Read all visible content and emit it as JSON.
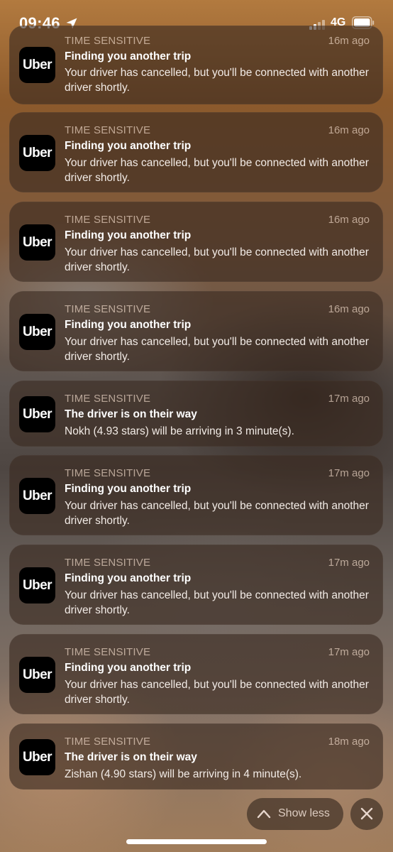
{
  "status_bar": {
    "time": "09:46",
    "network": "4G",
    "icons": [
      "location-arrow-icon",
      "signal-icon",
      "battery-icon"
    ]
  },
  "notifications": [
    {
      "app_icon_label": "Uber",
      "category": "TIME SENSITIVE",
      "time": "16m ago",
      "title": "Finding you another trip",
      "body": "Your driver has cancelled, but you'll be connected with another driver shortly."
    },
    {
      "app_icon_label": "Uber",
      "category": "TIME SENSITIVE",
      "time": "16m ago",
      "title": "Finding you another trip",
      "body": "Your driver has cancelled, but you'll be connected with another driver shortly."
    },
    {
      "app_icon_label": "Uber",
      "category": "TIME SENSITIVE",
      "time": "16m ago",
      "title": "Finding you another trip",
      "body": "Your driver has cancelled, but you'll be connected with another driver shortly."
    },
    {
      "app_icon_label": "Uber",
      "category": "TIME SENSITIVE",
      "time": "16m ago",
      "title": "Finding you another trip",
      "body": "Your driver has cancelled, but you'll be connected with another driver shortly."
    },
    {
      "app_icon_label": "Uber",
      "category": "TIME SENSITIVE",
      "time": "17m ago",
      "title": "The driver is on their way",
      "body": "Nokh (4.93 stars) will be arriving in 3 minute(s)."
    },
    {
      "app_icon_label": "Uber",
      "category": "TIME SENSITIVE",
      "time": "17m ago",
      "title": "Finding you another trip",
      "body": "Your driver has cancelled, but you'll be connected with another driver shortly."
    },
    {
      "app_icon_label": "Uber",
      "category": "TIME SENSITIVE",
      "time": "17m ago",
      "title": "Finding you another trip",
      "body": "Your driver has cancelled, but you'll be connected with another driver shortly."
    },
    {
      "app_icon_label": "Uber",
      "category": "TIME SENSITIVE",
      "time": "17m ago",
      "title": "Finding you another trip",
      "body": "Your driver has cancelled, but you'll be connected with another driver shortly."
    },
    {
      "app_icon_label": "Uber",
      "category": "TIME SENSITIVE",
      "time": "18m ago",
      "title": "The driver is on their way",
      "body": "Zishan (4.90 stars) will be arriving in 4 minute(s)."
    }
  ],
  "controls": {
    "show_less_label": "Show less",
    "show_less_icon": "chevron-up-icon",
    "clear_icon": "close-icon"
  }
}
